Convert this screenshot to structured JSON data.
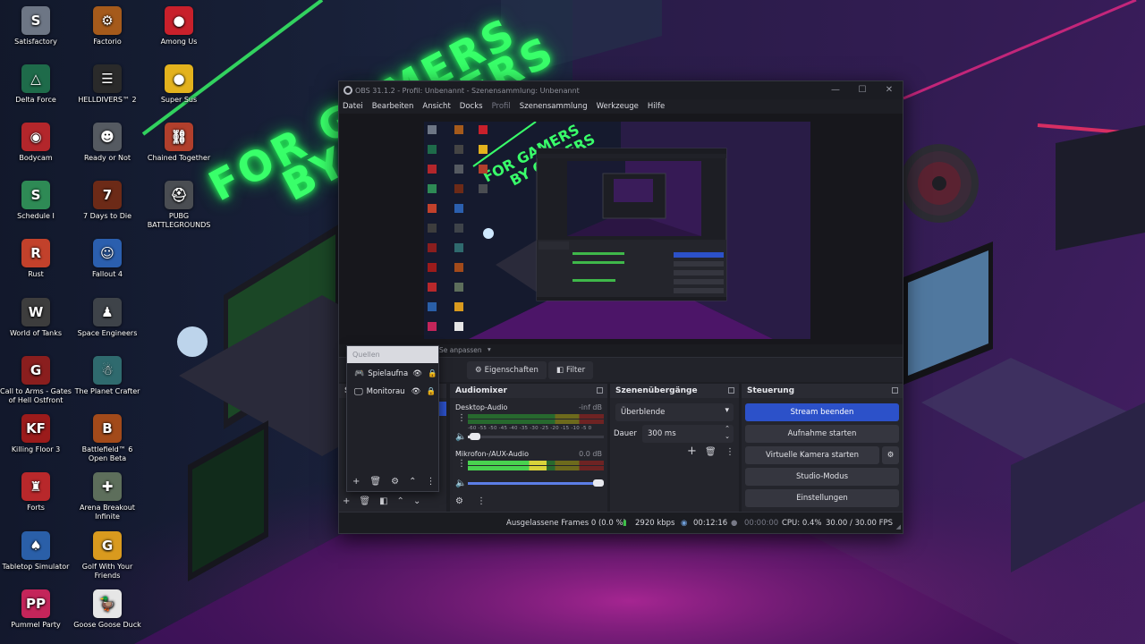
{
  "wallpaper": {
    "neon_line1": "FOR GAMERS",
    "neon_line2": "BY GAMERS"
  },
  "desktop_icons": [
    {
      "label": "Satisfactory",
      "icon": "satisfactory-icon",
      "color": "#6d7685",
      "glyph": "S"
    },
    {
      "label": "Factorio",
      "icon": "factorio-icon",
      "color": "#a55a1b",
      "glyph": "⚙"
    },
    {
      "label": "Among Us",
      "icon": "among-us-icon",
      "color": "#c8202b",
      "glyph": "●"
    },
    {
      "label": "Delta Force",
      "icon": "delta-force-icon",
      "color": "#1e6b4a",
      "glyph": "△"
    },
    {
      "label": "HELLDIVERS™ 2",
      "icon": "helldivers-icon",
      "color": "#2a2a2a",
      "glyph": "☰"
    },
    {
      "label": "Super Sus",
      "icon": "super-sus-icon",
      "color": "#e3b21d",
      "glyph": "●"
    },
    {
      "label": "Bodycam",
      "icon": "bodycam-icon",
      "color": "#b3262b",
      "glyph": "◉"
    },
    {
      "label": "Ready or Not",
      "icon": "ready-or-not-icon",
      "color": "#555a61",
      "glyph": "☻"
    },
    {
      "label": "Chained Together",
      "icon": "chained-together-icon",
      "color": "#b13f2c",
      "glyph": "⛓"
    },
    {
      "label": "Schedule I",
      "icon": "schedule-i-icon",
      "color": "#2e8a55",
      "glyph": "S"
    },
    {
      "label": "7 Days to Die",
      "icon": "seven-days-icon",
      "color": "#6c2a17",
      "glyph": "7"
    },
    {
      "label": "PUBG BATTLEGROUNDS",
      "icon": "pubg-icon",
      "color": "#4a4d52",
      "glyph": "⛑"
    },
    {
      "label": "Rust",
      "icon": "rust-icon",
      "color": "#c2412b",
      "glyph": "R"
    },
    {
      "label": "Fallout 4",
      "icon": "fallout-icon",
      "color": "#2b5fae",
      "glyph": "☺"
    },
    {
      "label": "World of Tanks",
      "icon": "world-of-tanks-icon",
      "color": "#3d3d3d",
      "glyph": "W"
    },
    {
      "label": "Space Engineers",
      "icon": "space-engineers-icon",
      "color": "#3e4349",
      "glyph": "♟"
    },
    {
      "label": "Call to Arms - Gates of Hell Ostfront",
      "icon": "call-to-arms-icon",
      "color": "#8a1e1e",
      "glyph": "G"
    },
    {
      "label": "The Planet Crafter",
      "icon": "planet-crafter-icon",
      "color": "#2f6a6e",
      "glyph": "☃"
    },
    {
      "label": "Killing Floor 3",
      "icon": "killing-floor-icon",
      "color": "#9b1b1b",
      "glyph": "KF"
    },
    {
      "label": "Battlefield™ 6 Open Beta",
      "icon": "battlefield-icon",
      "color": "#a24a1a",
      "glyph": "B"
    },
    {
      "label": "Forts",
      "icon": "forts-icon",
      "color": "#b8282b",
      "glyph": "♜"
    },
    {
      "label": "Arena Breakout Infinite",
      "icon": "arena-breakout-icon",
      "color": "#5d6e5b",
      "glyph": "✚"
    },
    {
      "label": "Tabletop Simulator",
      "icon": "tabletop-simulator-icon",
      "color": "#2a5fa8",
      "glyph": "♠"
    },
    {
      "label": "Golf With Your Friends",
      "icon": "golf-icon",
      "color": "#d99a1e",
      "glyph": "G"
    },
    {
      "label": "Pummel Party",
      "icon": "pummel-party-icon",
      "color": "#c4255a",
      "glyph": "PP"
    },
    {
      "label": "Goose Goose Duck",
      "icon": "goose-goose-duck-icon",
      "color": "#e6e6e6",
      "glyph": "🦆"
    }
  ],
  "obs": {
    "title": "OBS 31.1.2 - Profil: Unbenannt - Szenensammlung: Unbenannt",
    "menu": [
      "Datei",
      "Bearbeiten",
      "Ansicht",
      "Docks",
      "Profil",
      "Szenensammlung",
      "Werkzeuge",
      "Hilfe"
    ],
    "toolbar_partial": "Se anpassen",
    "properties_label": "Eigenschaften",
    "filter_label": "Filter",
    "scenes_head_partial": "S",
    "audiomixer": {
      "title": "Audiomixer",
      "channels": [
        {
          "name": "Desktop-Audio",
          "db": "-inf dB",
          "level": 0.0,
          "volume": 0.05
        },
        {
          "name": "Mikrofon-/AUX-Audio",
          "db": "0.0 dB",
          "level": 0.58,
          "volume": 1.0
        }
      ],
      "scale": "-60 -55 -50 -45 -40 -35 -30 -25 -20 -15 -10 -5 0"
    },
    "transitions": {
      "title": "Szenenübergänge",
      "selected": "Überblende",
      "duration_label": "Dauer",
      "duration_value": "300 ms"
    },
    "controls": {
      "title": "Steuerung",
      "buttons": [
        "Stream beenden",
        "Aufnahme starten",
        "Virtuelle Kamera starten",
        "Studio-Modus",
        "Einstellungen"
      ]
    },
    "status": {
      "dropped_frames": "Ausgelassene Frames 0 (0.0 %)",
      "bitrate": "2920 kbps",
      "stream_time": "00:12:16",
      "rec_time": "00:00:00",
      "cpu": "CPU: 0.4%",
      "fps": "30.00 / 30.00 FPS"
    },
    "colors": {
      "accent": "#2c51c9",
      "window_bg": "#1d1e24",
      "panel_bg": "#24252c"
    }
  },
  "quellen": {
    "title": "Quellen",
    "sources": [
      {
        "name": "Spielaufna",
        "icon": "gamepad-icon"
      },
      {
        "name": "Monitorau",
        "icon": "monitor-icon"
      }
    ]
  }
}
